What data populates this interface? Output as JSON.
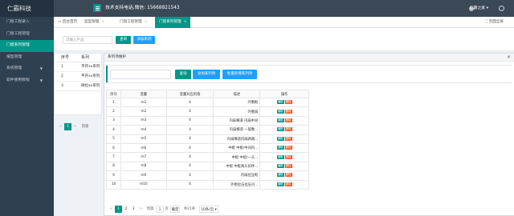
{
  "app": {
    "logo": "仁霸科技",
    "support_text": "技术支持电话,微信: 15668821543",
    "user_name": "仁霸之家"
  },
  "sidebar": {
    "items": [
      {
        "label": "门窗工程录入",
        "active": false
      },
      {
        "label": "门窗工程管理",
        "active": false
      },
      {
        "label": "门窗系列管理",
        "active": true
      },
      {
        "label": "报型管理",
        "active": false
      },
      {
        "label": "系统管理",
        "active": false,
        "has_arrow": true
      },
      {
        "label": "软件使用教程",
        "active": false,
        "has_arrow": true
      }
    ]
  },
  "tabs": [
    {
      "label": "后台首页",
      "active": false
    },
    {
      "label": "型型管理",
      "active": false
    },
    {
      "label": "门窗工程管理",
      "active": false
    },
    {
      "label": "门窗系列管理",
      "active": true
    }
  ],
  "fullscreen_label": "页面全屏",
  "filter": {
    "placeholder": "可输入产品",
    "search_label": "查询",
    "add_label": "添加系列"
  },
  "bg_table": {
    "headers": [
      "序号",
      "系列"
    ],
    "rows": [
      [
        "1",
        "平开xx系列"
      ],
      [
        "2",
        "平开xx系列"
      ],
      [
        "3",
        "微拉xx系列"
      ]
    ],
    "pager": {
      "current": "1",
      "prev": "<",
      "next": ">",
      "goto_label": "到第"
    }
  },
  "modal": {
    "title": "系列项维护",
    "search_label": "查询",
    "add_label": "添加系列项",
    "batch_label": "批量新增系列项",
    "headers": [
      "序号",
      "变量",
      "变量对应的值",
      "描述",
      "操作"
    ],
    "rows": [
      {
        "no": "1",
        "var": "m1",
        "val": "4",
        "desc": "外圈框"
      },
      {
        "no": "2",
        "var": "m2",
        "val": "4",
        "desc": "外圈扇"
      },
      {
        "no": "3",
        "var": "m3",
        "val": "4",
        "desc": "内扇横道 内扇中间"
      },
      {
        "no": "4",
        "var": "m4",
        "val": "4",
        "desc": "内扇横道 一般数..."
      },
      {
        "no": "5",
        "var": "m5",
        "val": "4",
        "desc": "内扇横道内扇两端..."
      },
      {
        "no": "6",
        "var": "m6",
        "val": "4",
        "desc": "中梃 中梃/中间内..."
      },
      {
        "no": "7",
        "var": "m7",
        "val": "4",
        "desc": "中梃 中梃/一头..."
      },
      {
        "no": "8",
        "var": "m8",
        "val": "4",
        "desc": "中梃 中梃两头扣件..."
      },
      {
        "no": "9",
        "var": "m9",
        "val": "4",
        "desc": "内扇拉压框"
      },
      {
        "no": "10",
        "var": "m10",
        "val": "4",
        "desc": "外框拉压拉压问..."
      }
    ],
    "edit_label": "编辑",
    "delete_label": "删除",
    "pager": {
      "prev": "<",
      "pages": [
        "1",
        "2",
        "3"
      ],
      "next": ">",
      "goto_label": "到第",
      "page_input": "1",
      "page_unit": "页",
      "confirm": "确定",
      "total": "共21条",
      "page_size": "10条/页"
    }
  }
}
